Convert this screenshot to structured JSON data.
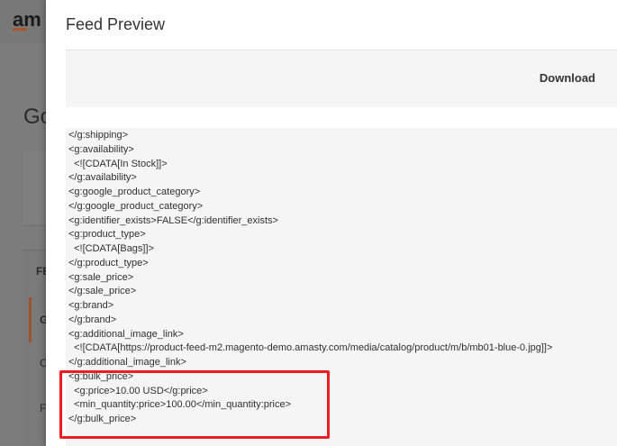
{
  "background": {
    "logo_text": "am",
    "page_title_fragment": "Go",
    "tab_labels": [
      "FEE",
      "G",
      "C",
      "Fe"
    ]
  },
  "modal": {
    "title": "Feed Preview",
    "download_label": "Download",
    "code_lines": [
      "</g:shipping>",
      "<g:availability>",
      "  <![CDATA[In Stock]]>",
      "</g:availability>",
      "<g:google_product_category>",
      "</g:google_product_category>",
      "<g:identifier_exists>FALSE</g:identifier_exists>",
      "<g:product_type>",
      "  <![CDATA[Bags]]>",
      "</g:product_type>",
      "<g:sale_price>",
      "</g:sale_price>",
      "<g:brand>",
      "</g:brand>",
      "<g:additional_image_link>",
      "  <![CDATA[https://product-feed-m2.magento-demo.amasty.com/media/catalog/product/m/b/mb01-blue-0.jpg]]>",
      "</g:additional_image_link>",
      "<g:bulk_price>",
      "  <g:price>10.00 USD</g:price>",
      "  <min_quantity:price>100.00</min_quantity:price>",
      "</g:bulk_price>"
    ]
  },
  "colors": {
    "highlight": "#ee1c25",
    "accent": "#a0522d"
  }
}
